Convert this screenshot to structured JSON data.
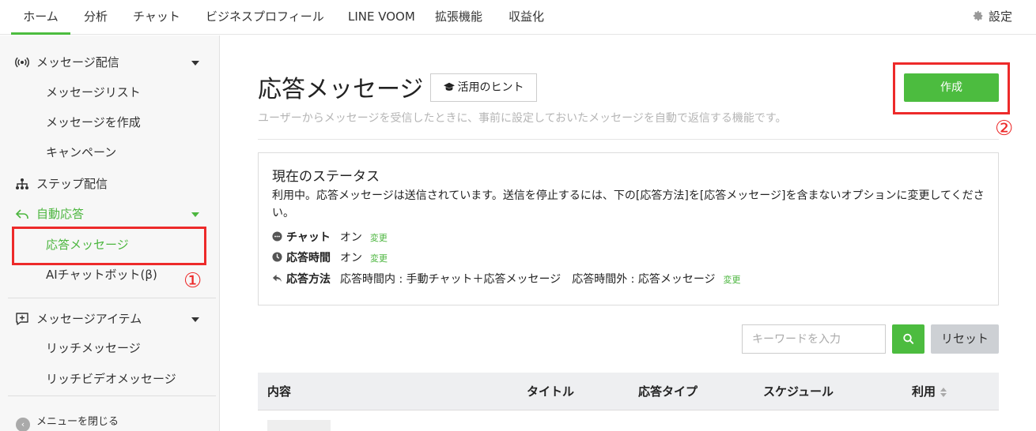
{
  "topnav": {
    "tabs": [
      "ホーム",
      "分析",
      "チャット",
      "ビジネスプロフィール",
      "LINE VOOM",
      "拡張機能",
      "収益化"
    ],
    "active_tab": "ホーム",
    "settings_label": "設定"
  },
  "sidebar": {
    "message_delivery": "メッセージ配信",
    "message_list": "メッセージリスト",
    "create_message": "メッセージを作成",
    "campaign": "キャンペーン",
    "step_delivery": "ステップ配信",
    "auto_response": "自動応答",
    "response_message": "応答メッセージ",
    "ai_chatbot": "AIチャットボット(β)",
    "message_items": "メッセージアイテム",
    "rich_message": "リッチメッセージ",
    "rich_video_message": "リッチビデオメッセージ",
    "close_menu": "メニューを閉じる",
    "annotation_1": "①"
  },
  "main": {
    "title": "応答メッセージ",
    "hint_button": "活用のヒント",
    "description": "ユーザーからメッセージを受信したときに、事前に設定しておいたメッセージを自動で返信する機能です。",
    "create_button": "作成",
    "annotation_2": "②",
    "status": {
      "title": "現在のステータス",
      "text": "利用中。応答メッセージは送信されています。送信を停止するには、下の[応答方法]を[応答メッセージ]を含まないオプションに変更してください。",
      "chat_label": "チャット",
      "chat_value": "オン",
      "hours_label": "応答時間",
      "hours_value": "オン",
      "method_label": "応答方法",
      "method_value": "応答時間内 : 手動チャット＋応答メッセージ　応答時間外 : 応答メッセージ",
      "change_label": "変更"
    },
    "search": {
      "placeholder": "キーワードを入力",
      "value": "",
      "reset_label": "リセット"
    },
    "table": {
      "headers": [
        "内容",
        "タイトル",
        "応答タイプ",
        "スケジュール",
        "利用"
      ]
    }
  },
  "colors": {
    "accent_green": "#4cbc3f",
    "annotation_red": "#ed2a2a"
  },
  "icons": [
    "gear-icon",
    "broadcast-icon",
    "step-tree-icon",
    "reply-icon",
    "message-plus-icon",
    "graduation-cap-icon",
    "chat-bubble-icon",
    "clock-icon",
    "search-icon",
    "sort-icon",
    "chevron-left-icon"
  ]
}
